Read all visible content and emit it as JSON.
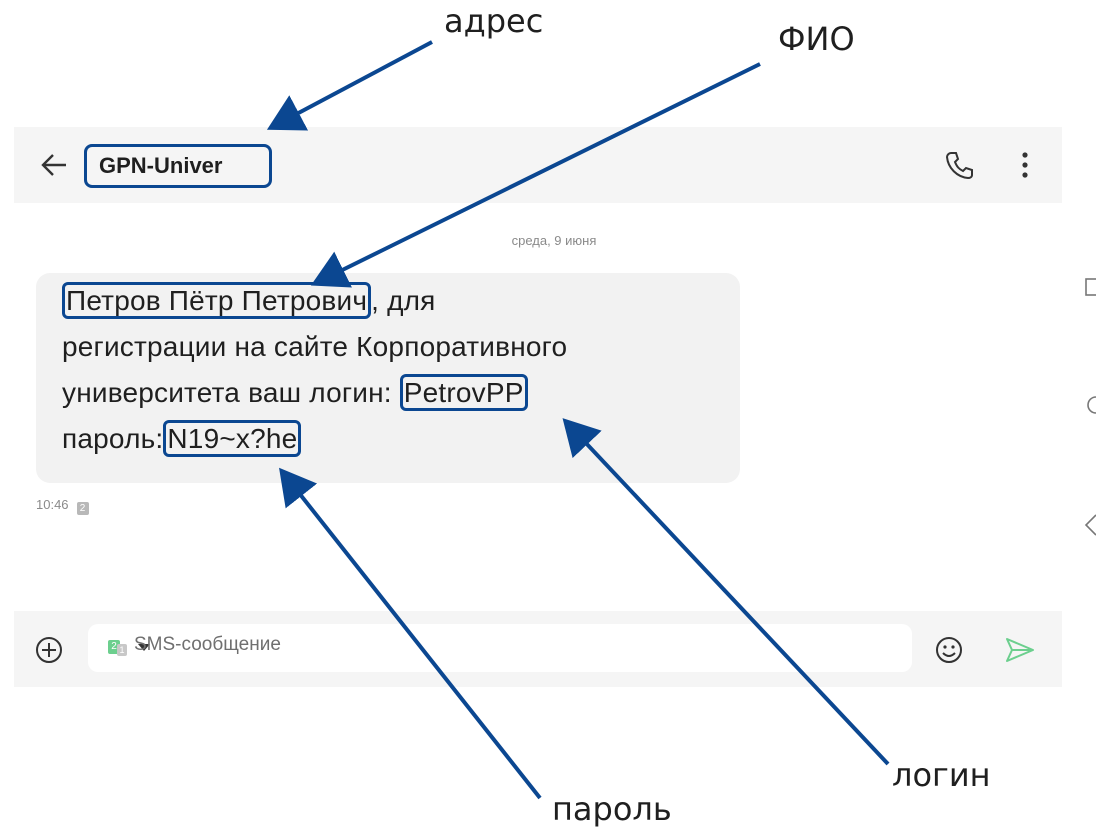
{
  "header": {
    "contact_name": "GPN-Univer"
  },
  "chat": {
    "date": "среда, 9 июня",
    "message": {
      "line1_name": "Петров Пётр Петрович",
      "line1_rest": ", для",
      "line2": "регистрации на сайте Корпоративного",
      "line3_prefix": "университета ваш логин: ",
      "login": "PetrovPP",
      "line4_prefix": "пароль:",
      "password": "N19~x?he"
    },
    "time": "10:46",
    "sim_slot": "2"
  },
  "input": {
    "sim_primary": "2",
    "sim_secondary": "1",
    "placeholder": "SMS-сообщение"
  },
  "annotations": {
    "address": "адрес",
    "fio": "ФИО",
    "login": "логин",
    "password": "пароль"
  },
  "colors": {
    "highlight_border": "#0b4791",
    "arrow": "#0b4791",
    "send_icon": "#6ccf8e",
    "header_bg": "#f5f5f5",
    "bubble_bg": "#f2f2f2"
  },
  "icons": [
    "back-arrow-icon",
    "phone-icon",
    "more-vertical-icon",
    "add-circle-icon",
    "emoji-icon",
    "send-icon",
    "square-icon",
    "circle-icon",
    "chevron-left-icon"
  ]
}
